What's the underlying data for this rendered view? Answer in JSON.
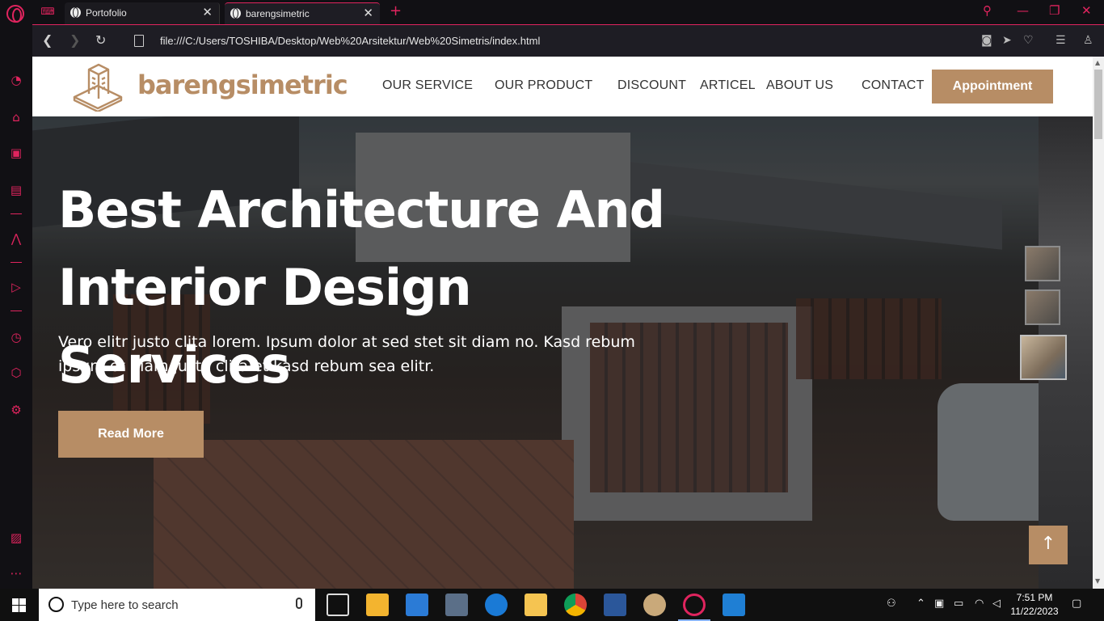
{
  "browser": {
    "tabs": [
      {
        "title": "Portofolio",
        "active": false
      },
      {
        "title": "barengsimetric",
        "active": true
      }
    ],
    "new_tab_symbol": "+",
    "url": "file:///C:/Users/TOSHIBA/Desktop/Web%20Arsitektur/Web%20Simetris/index.html",
    "accent_color": "#e0245e"
  },
  "site": {
    "brand": "barengsimetric",
    "brand_color": "#b78d65",
    "menu": [
      "OUR SERVICE",
      "OUR PRODUCT",
      "DISCOUNT",
      "ARTICEL",
      "ABOUT US",
      "CONTACT"
    ],
    "appointment_label": "Appointment"
  },
  "hero": {
    "title_line1": "Best Architecture And",
    "title_line2": "Interior Design Services",
    "subtitle": "Vero elitr justo clita lorem. Ipsum dolor at sed stet sit diam no. Kasd rebum ipsum et diam justo clita et kasd rebum sea elitr.",
    "read_more_label": "Read More",
    "back_to_top_symbol": "↑"
  },
  "taskbar": {
    "search_placeholder": "Type here to search",
    "time": "7:51 PM",
    "date": "11/22/2023"
  }
}
